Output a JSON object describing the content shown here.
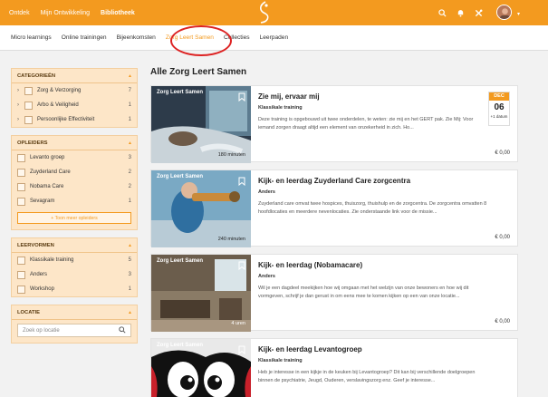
{
  "topnav": {
    "items": [
      {
        "label": "Ontdek"
      },
      {
        "label": "Mijn Ontwikkeling"
      },
      {
        "label": "Bibliotheek"
      }
    ]
  },
  "subnav": {
    "tabs": [
      {
        "label": "Micro learnings"
      },
      {
        "label": "Online trainingen"
      },
      {
        "label": "Bijeenkomsten"
      },
      {
        "label": "Zorg Leert Samen"
      },
      {
        "label": "Collecties"
      },
      {
        "label": "Leerpaden"
      }
    ]
  },
  "sidebar": {
    "categories": {
      "title": "CATEGORIEËN",
      "items": [
        {
          "label": "Zorg & Verzorging",
          "count": "7"
        },
        {
          "label": "Arbo & Veiligheid",
          "count": "1"
        },
        {
          "label": "Persoonlijke Effectiviteit",
          "count": "1"
        }
      ]
    },
    "providers": {
      "title": "OPLEIDERS",
      "items": [
        {
          "label": "Levanto groep",
          "count": "3"
        },
        {
          "label": "Zuyderland Care",
          "count": "2"
        },
        {
          "label": "Nobama Care",
          "count": "2"
        },
        {
          "label": "Sevagram",
          "count": "1"
        }
      ],
      "more_label": "+ Toon meer opleiders"
    },
    "forms": {
      "title": "LEERVORMEN",
      "items": [
        {
          "label": "Klassikale training",
          "count": "5"
        },
        {
          "label": "Anders",
          "count": "3"
        },
        {
          "label": "Workshop",
          "count": "1"
        }
      ]
    },
    "location": {
      "title": "LOCATIE",
      "placeholder": "Zoek op locatie"
    }
  },
  "main": {
    "title": "Alle Zorg Leert Samen",
    "cards": [
      {
        "brand": "Zorg Leert Samen",
        "title": "Zie mij, ervaar mij",
        "type": "Klassikale training",
        "desc": "Deze training is opgebouwd uit twee onderdelen, te weten: zie mij en het GERT pak. Zie Mij: Voor iemand zorgen draagt altijd een element van onzekerheid in zich. Ho...",
        "duration": "180 minuten",
        "price": "€ 0,00",
        "date_month": "DEC",
        "date_day": "06",
        "date_more": "+1 datum"
      },
      {
        "brand": "Zorg Leert Samen",
        "title": "Kijk- en leerdag Zuyderland Care zorgcentra",
        "type": "Anders",
        "desc": "Zuyderland care omvat twee hospices, thuiszorg, thuishulp en de zorgcentra. De zorgcentra omvatten 8 hoofdlocaties en meerdere nevenlocaties. Zie onderstaande link voor de missie...",
        "duration": "240 minuten",
        "price": "€ 0,00"
      },
      {
        "brand": "Zorg Leert Samen",
        "title": "Kijk- en leerdag (Nobamacare)",
        "type": "Anders",
        "desc": "Wil je een dagdeel meekijken hoe wij omgaan met het welzijn van onze bewoners en hoe wij dit vormgeven, schrijf je dan gerust in om eens mee te komen kijken op een van onze locatie...",
        "duration": "4 uren",
        "price": "€ 0,00"
      },
      {
        "brand": "Zorg Leert Samen",
        "title": "Kijk- en leerdag Levantogroep",
        "type": "Klassikale training",
        "desc": "Heb je interesse in een kijkje in de keuken bij Levantogroep? Dit kan bij verschillende doelgroepen binnen de psychiatrie, Jeugd, Ouderen, verslavingszorg enz. Geef je interesse...",
        "duration": "",
        "price": ""
      }
    ]
  },
  "colors": {
    "brand_orange": "#f39a1f",
    "annotation_red": "#dd2222",
    "filter_panel": "#fde6c8"
  }
}
